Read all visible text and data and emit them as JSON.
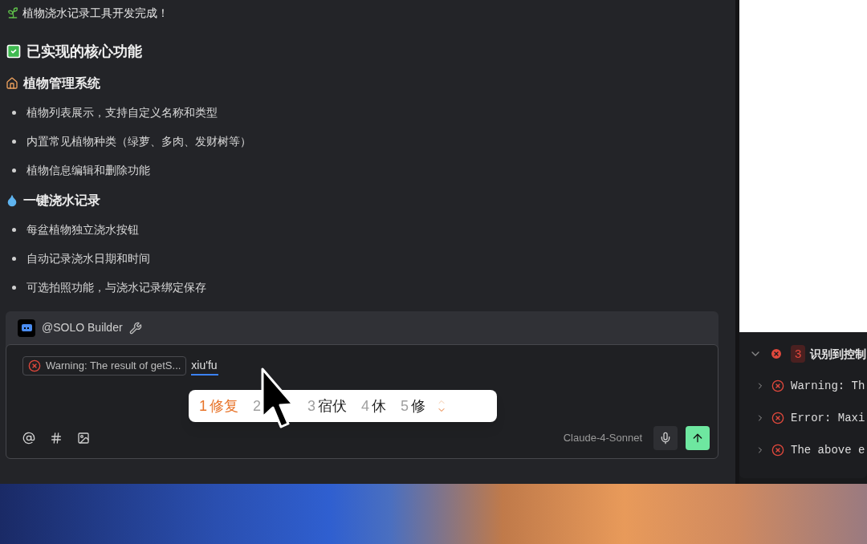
{
  "message": {
    "title": "植物浇水记录工具开发完成！",
    "heading": "已实现的核心功能",
    "sections": [
      {
        "kind": "house",
        "title": "植物管理系统",
        "items": [
          "植物列表展示，支持自定义名称和类型",
          "内置常见植物种类（绿萝、多肉、发财树等）",
          "植物信息编辑和删除功能"
        ]
      },
      {
        "kind": "droplet",
        "title": "一键浇水记录",
        "items": [
          "每盆植物独立浇水按钮",
          "自动记录浇水日期和时间",
          "可选拍照功能，与浇水记录绑定保存"
        ]
      }
    ]
  },
  "composer": {
    "agent": "@SOLO Builder",
    "chip": "Warning: The result of getS...",
    "input": "xiu'fu",
    "model": "Claude-4-Sonnet"
  },
  "ime": {
    "candidates": [
      {
        "number": "1",
        "word": "修复",
        "selected": true
      },
      {
        "number": "2",
        "selected": false
      },
      {
        "number": "3",
        "word": "宿伏",
        "selected": false
      },
      {
        "number": "4",
        "word": "休",
        "selected": false
      },
      {
        "number": "5",
        "word": "修",
        "selected": false
      }
    ]
  },
  "console": {
    "expanded": true,
    "count": "3",
    "title": "识别到控制",
    "rows": [
      {
        "text": "Warning: Th",
        "expanded": false
      },
      {
        "text": "Error: Maxi",
        "expanded": false
      },
      {
        "text": "The above e",
        "expanded": false
      }
    ]
  }
}
